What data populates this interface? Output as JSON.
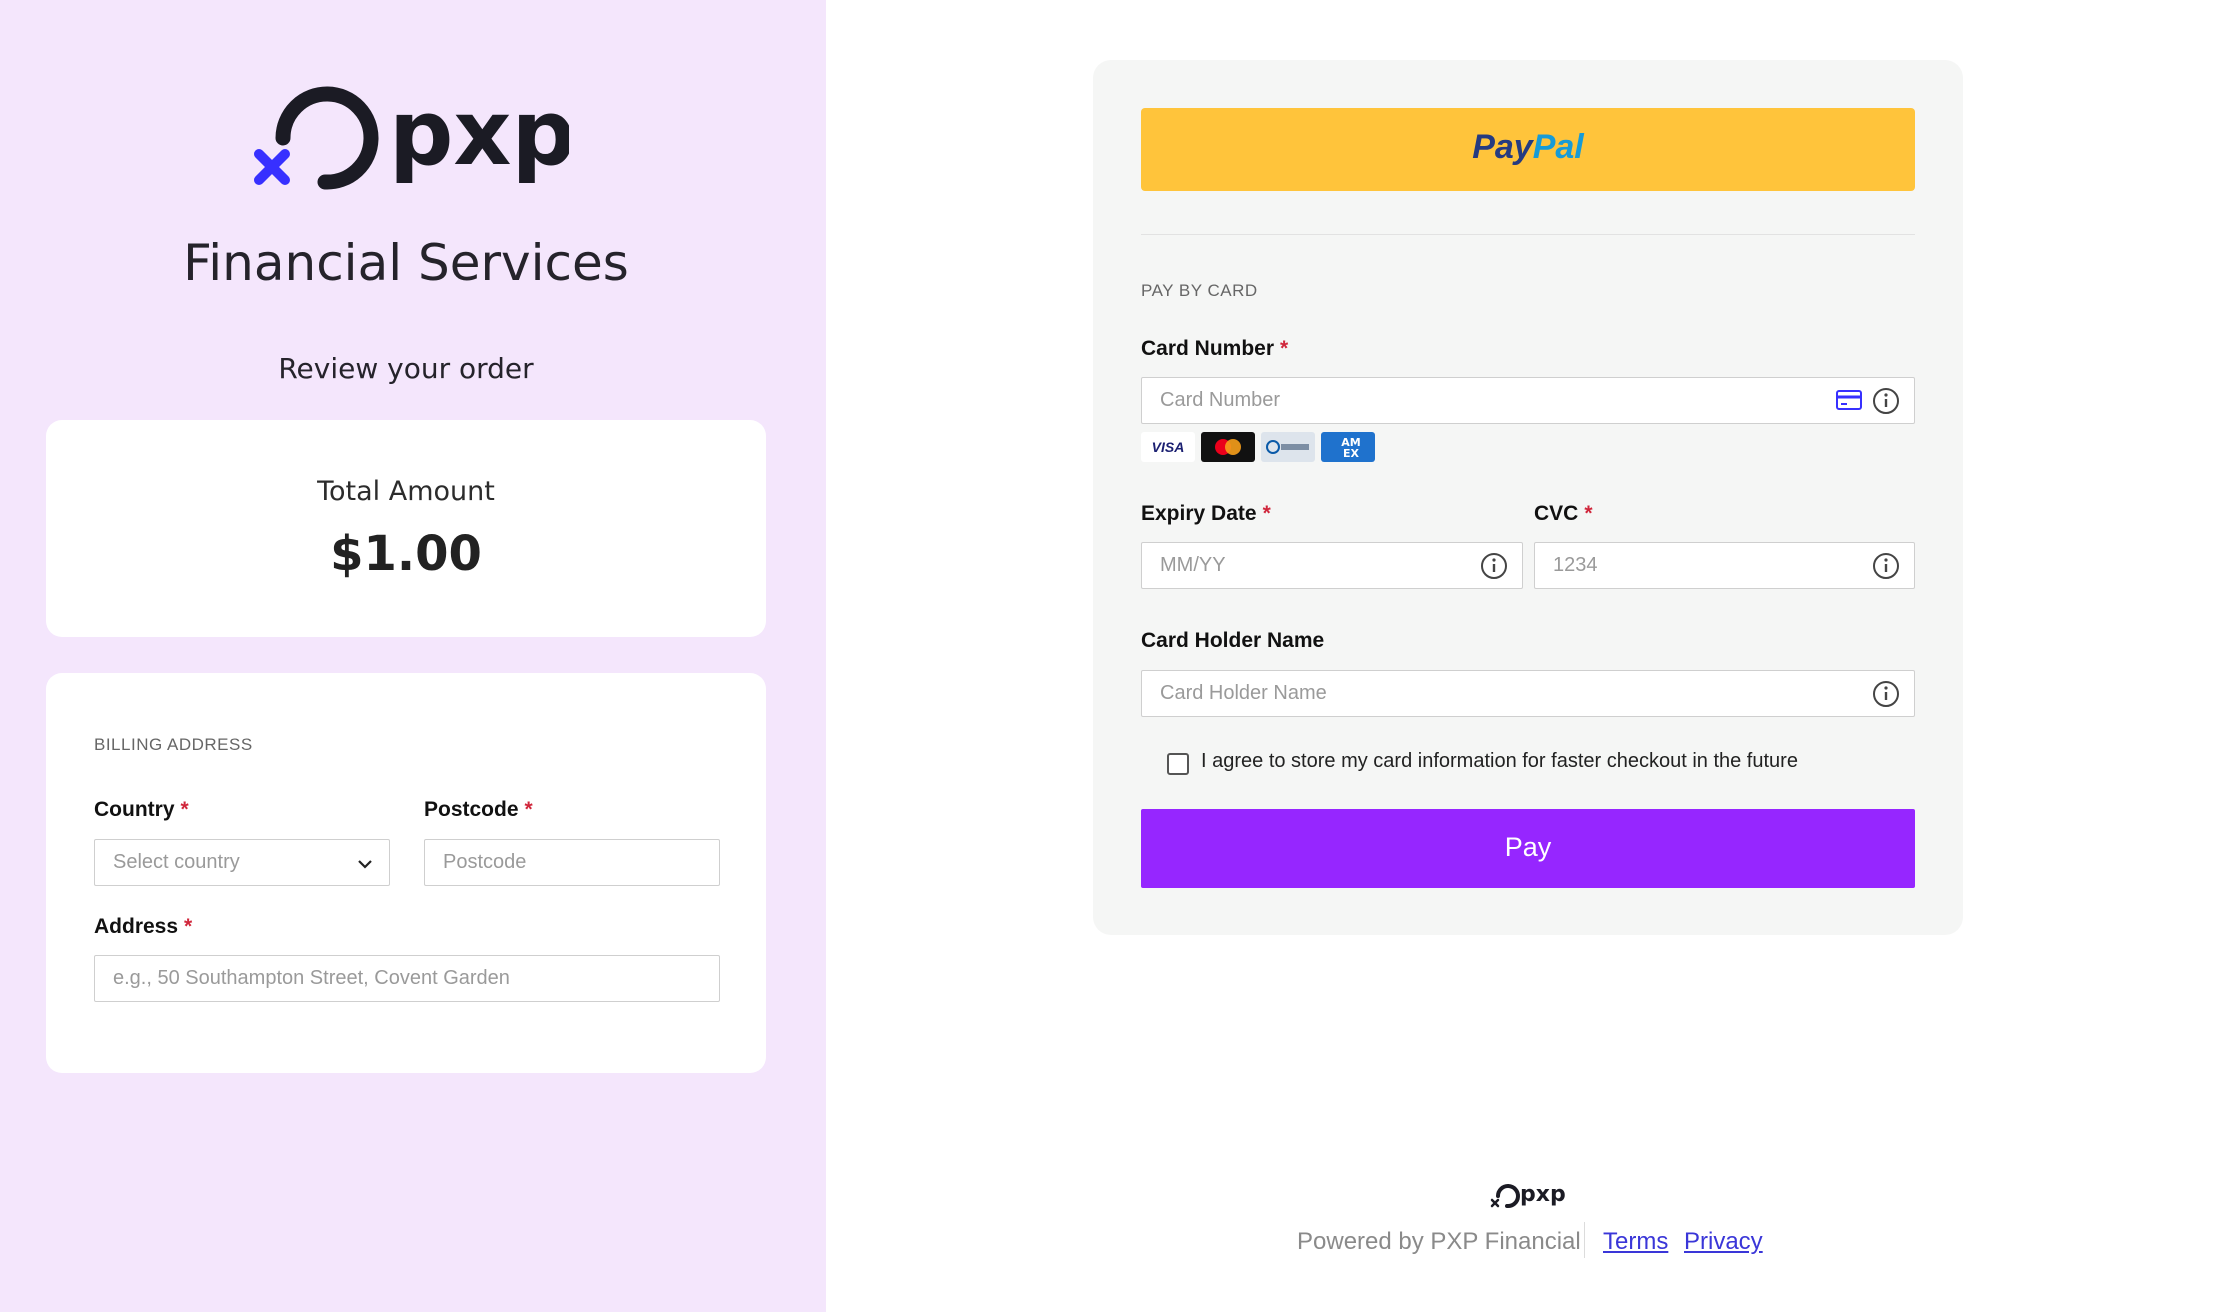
{
  "brand": {
    "logo_text": "pxp",
    "title": "Financial Services"
  },
  "order": {
    "review_heading": "Review your order",
    "total_label": "Total Amount",
    "total_value": "$1.00"
  },
  "billing": {
    "section_label": "BILLING ADDRESS",
    "country_label": "Country",
    "country_placeholder": "Select country",
    "postcode_label": "Postcode",
    "postcode_placeholder": "Postcode",
    "address_label": "Address",
    "address_placeholder": "e.g., 50 Southampton Street, Covent Garden",
    "required_mark": "*"
  },
  "payment": {
    "paypal_part1": "Pay",
    "paypal_part2": "Pal",
    "section_label": "PAY BY CARD",
    "card_number_label": "Card Number",
    "card_number_placeholder": "Card Number",
    "card_brands": [
      "VISA",
      "Mastercard",
      "Diners Club",
      "AMEX"
    ],
    "expiry_label": "Expiry Date",
    "expiry_placeholder": "MM/YY",
    "cvc_label": "CVC",
    "cvc_placeholder": "1234",
    "holder_label": "Card Holder Name",
    "holder_placeholder": "Card Holder Name",
    "agree_text": "I agree to store my card information for faster checkout in the future",
    "pay_button": "Pay"
  },
  "footer": {
    "logo_text": "pxp",
    "powered_by": "Powered by PXP Financial",
    "terms": "Terms",
    "privacy": "Privacy"
  },
  "colors": {
    "left_panel_bg": "#f4e6fc",
    "paypal_yellow": "#ffc43b",
    "pay_purple": "#9626ff",
    "required_red": "#d0263b",
    "brand_blue": "#3730ff"
  }
}
